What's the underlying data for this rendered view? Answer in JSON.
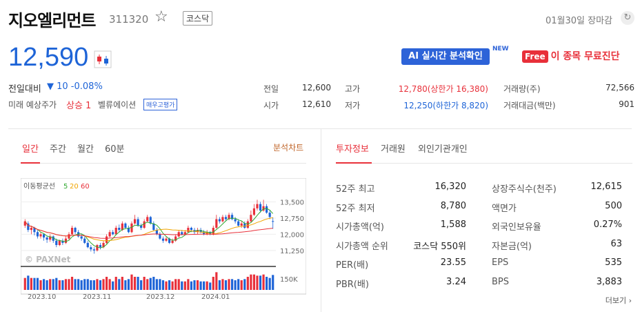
{
  "header": {
    "name": "지오엘리먼트",
    "code": "311320",
    "market": "코스닥",
    "date_status": "01월30일 장마감"
  },
  "price": {
    "current": "12,590",
    "change_label": "전일대비",
    "change_value": "▼ 10 -0.08%",
    "expect_label": "미래 예상주가",
    "expect_value": "상승 1",
    "valuation_label": "벨류에이션",
    "valuation_badge": "매우고평가"
  },
  "promo": {
    "ai_label": "AI 실시간 분석확인",
    "new_label": "NEW",
    "free_badge": "Free",
    "free_label": "이 종목 무료진단"
  },
  "quotes": [
    {
      "label": "전일",
      "value": "12,600"
    },
    {
      "label": "시가",
      "value": "12,610"
    },
    {
      "label": "고가",
      "value": "12,780(상한가 16,380)"
    },
    {
      "label": "저가",
      "value": "12,250(하한가 8,820)"
    },
    {
      "label": "거래량(주)",
      "value": "72,566"
    },
    {
      "label": "거래대금(백만)",
      "value": "901"
    }
  ],
  "chart_tabs": [
    "일간",
    "주간",
    "월간",
    "60분"
  ],
  "chart_link": "분석차트",
  "info_tabs": [
    "투자정보",
    "거래원",
    "외인기관개인"
  ],
  "chart_data": {
    "type": "candlestick",
    "ma_label": "이동평균선",
    "ma_series": [
      {
        "name": "5",
        "color": "#2fa82f"
      },
      {
        "name": "20",
        "color": "#f0a500"
      },
      {
        "name": "60",
        "color": "#e8303a"
      }
    ],
    "y_ticks": [
      "13,500",
      "12,750",
      "12,000",
      "11,250"
    ],
    "ylim": [
      10700,
      13900
    ],
    "volume_tick": "150K",
    "x_ticks": [
      "2023.10",
      "2023.11",
      "2023.12",
      "2024.01"
    ],
    "watermark": "© PAXNet",
    "candles": [
      [
        12400,
        12600,
        12300,
        12700
      ],
      [
        12500,
        12200,
        12100,
        12600
      ],
      [
        12200,
        12300,
        12000,
        12400
      ],
      [
        12300,
        12100,
        11950,
        12350
      ],
      [
        12100,
        11900,
        11800,
        12200
      ],
      [
        11900,
        12000,
        11800,
        12100
      ],
      [
        12000,
        11850,
        11700,
        12050
      ],
      [
        11850,
        11750,
        11600,
        11900
      ],
      [
        11750,
        11900,
        11650,
        12000
      ],
      [
        11900,
        11700,
        11600,
        11950
      ],
      [
        11700,
        11500,
        11400,
        11800
      ],
      [
        11500,
        11700,
        11450,
        11750
      ],
      [
        11700,
        11600,
        11500,
        11800
      ],
      [
        11600,
        11800,
        11550,
        11900
      ],
      [
        11800,
        12000,
        11750,
        12100
      ],
      [
        12000,
        12300,
        11950,
        12400
      ],
      [
        12300,
        12100,
        12000,
        12350
      ],
      [
        12100,
        11900,
        11850,
        12200
      ],
      [
        11900,
        11800,
        11700,
        12000
      ],
      [
        11800,
        11600,
        11550,
        11900
      ],
      [
        11600,
        11400,
        11350,
        11700
      ],
      [
        11400,
        11300,
        11200,
        11500
      ],
      [
        11300,
        11250,
        11100,
        11400
      ],
      [
        11250,
        11500,
        11200,
        11550
      ],
      [
        11500,
        11400,
        11300,
        11600
      ],
      [
        11400,
        11600,
        11350,
        11700
      ],
      [
        11600,
        11900,
        11550,
        12000
      ],
      [
        11900,
        12100,
        11850,
        12200
      ],
      [
        12100,
        12000,
        11950,
        12200
      ],
      [
        12000,
        12300,
        11950,
        12400
      ],
      [
        12300,
        12200,
        12100,
        12450
      ],
      [
        12200,
        12500,
        12150,
        12600
      ],
      [
        12500,
        12300,
        12250,
        12550
      ],
      [
        12300,
        12100,
        12050,
        12400
      ],
      [
        12100,
        12500,
        12050,
        12600
      ],
      [
        12500,
        12700,
        12450,
        12900
      ],
      [
        12700,
        12400,
        12350,
        12800
      ],
      [
        12400,
        12300,
        12200,
        12500
      ],
      [
        12300,
        12600,
        12250,
        12700
      ],
      [
        12600,
        12800,
        12550,
        12900
      ],
      [
        12800,
        12500,
        12450,
        12850
      ],
      [
        12500,
        12200,
        12150,
        12600
      ],
      [
        12200,
        12000,
        11950,
        12300
      ],
      [
        12000,
        11800,
        11750,
        12100
      ],
      [
        11800,
        11700,
        11600,
        11900
      ],
      [
        11700,
        11800,
        11650,
        11900
      ],
      [
        11800,
        11600,
        11550,
        11850
      ],
      [
        11600,
        11700,
        11550,
        11800
      ],
      [
        11700,
        11900,
        11650,
        12000
      ],
      [
        11900,
        12100,
        11850,
        12200
      ],
      [
        12100,
        12000,
        11950,
        12200
      ],
      [
        12000,
        12100,
        11950,
        12200
      ],
      [
        12100,
        12300,
        12050,
        12400
      ],
      [
        12300,
        12200,
        12100,
        12350
      ],
      [
        12200,
        12100,
        12000,
        12300
      ],
      [
        12100,
        12200,
        12000,
        12300
      ],
      [
        12200,
        12100,
        12050,
        12300
      ],
      [
        12100,
        12000,
        11950,
        12200
      ],
      [
        12000,
        12100,
        11950,
        12200
      ],
      [
        12100,
        12000,
        11950,
        12150
      ],
      [
        12000,
        12300,
        11950,
        12400
      ],
      [
        12300,
        12700,
        12250,
        12900
      ],
      [
        12700,
        12600,
        12500,
        12800
      ],
      [
        12600,
        12800,
        12550,
        12900
      ],
      [
        12800,
        12700,
        12600,
        12900
      ],
      [
        12700,
        12900,
        12650,
        13000
      ],
      [
        12900,
        12700,
        12650,
        13000
      ],
      [
        12700,
        12600,
        12500,
        12800
      ],
      [
        12600,
        12400,
        12350,
        12700
      ],
      [
        12400,
        12500,
        12300,
        12600
      ],
      [
        12500,
        12300,
        12250,
        12600
      ],
      [
        12300,
        12600,
        12250,
        12700
      ],
      [
        12600,
        12900,
        12550,
        13100
      ],
      [
        12900,
        13200,
        12850,
        13400
      ],
      [
        13200,
        13400,
        13100,
        13600
      ],
      [
        13400,
        13100,
        13000,
        13500
      ],
      [
        13100,
        13300,
        13050,
        13600
      ],
      [
        13300,
        13000,
        12950,
        13400
      ],
      [
        13000,
        12800,
        12700,
        13100
      ],
      [
        12610,
        12590,
        12250,
        12780
      ]
    ]
  },
  "investment": [
    {
      "label": "52주 최고",
      "value": "16,320"
    },
    {
      "label": "52주 최저",
      "value": "8,780"
    },
    {
      "label": "시가총액(억)",
      "value": "1,588"
    },
    {
      "label": "시가총액 순위",
      "value": "코스닥 550위"
    },
    {
      "label": "PER(배)",
      "value": "23.55"
    },
    {
      "label": "PBR(배)",
      "value": "3.24"
    },
    {
      "label": "상장주식수(천주)",
      "value": "12,615"
    },
    {
      "label": "액면가",
      "value": "500"
    },
    {
      "label": "외국인보유율",
      "value": "0.27%"
    },
    {
      "label": "자본금(억)",
      "value": "63"
    },
    {
      "label": "EPS",
      "value": "535"
    },
    {
      "label": "BPS",
      "value": "3,883"
    }
  ],
  "more_label": "더보기",
  "colors": {
    "up": "#e8303a",
    "down": "#1e64d7",
    "accent": "#2d63d8"
  }
}
